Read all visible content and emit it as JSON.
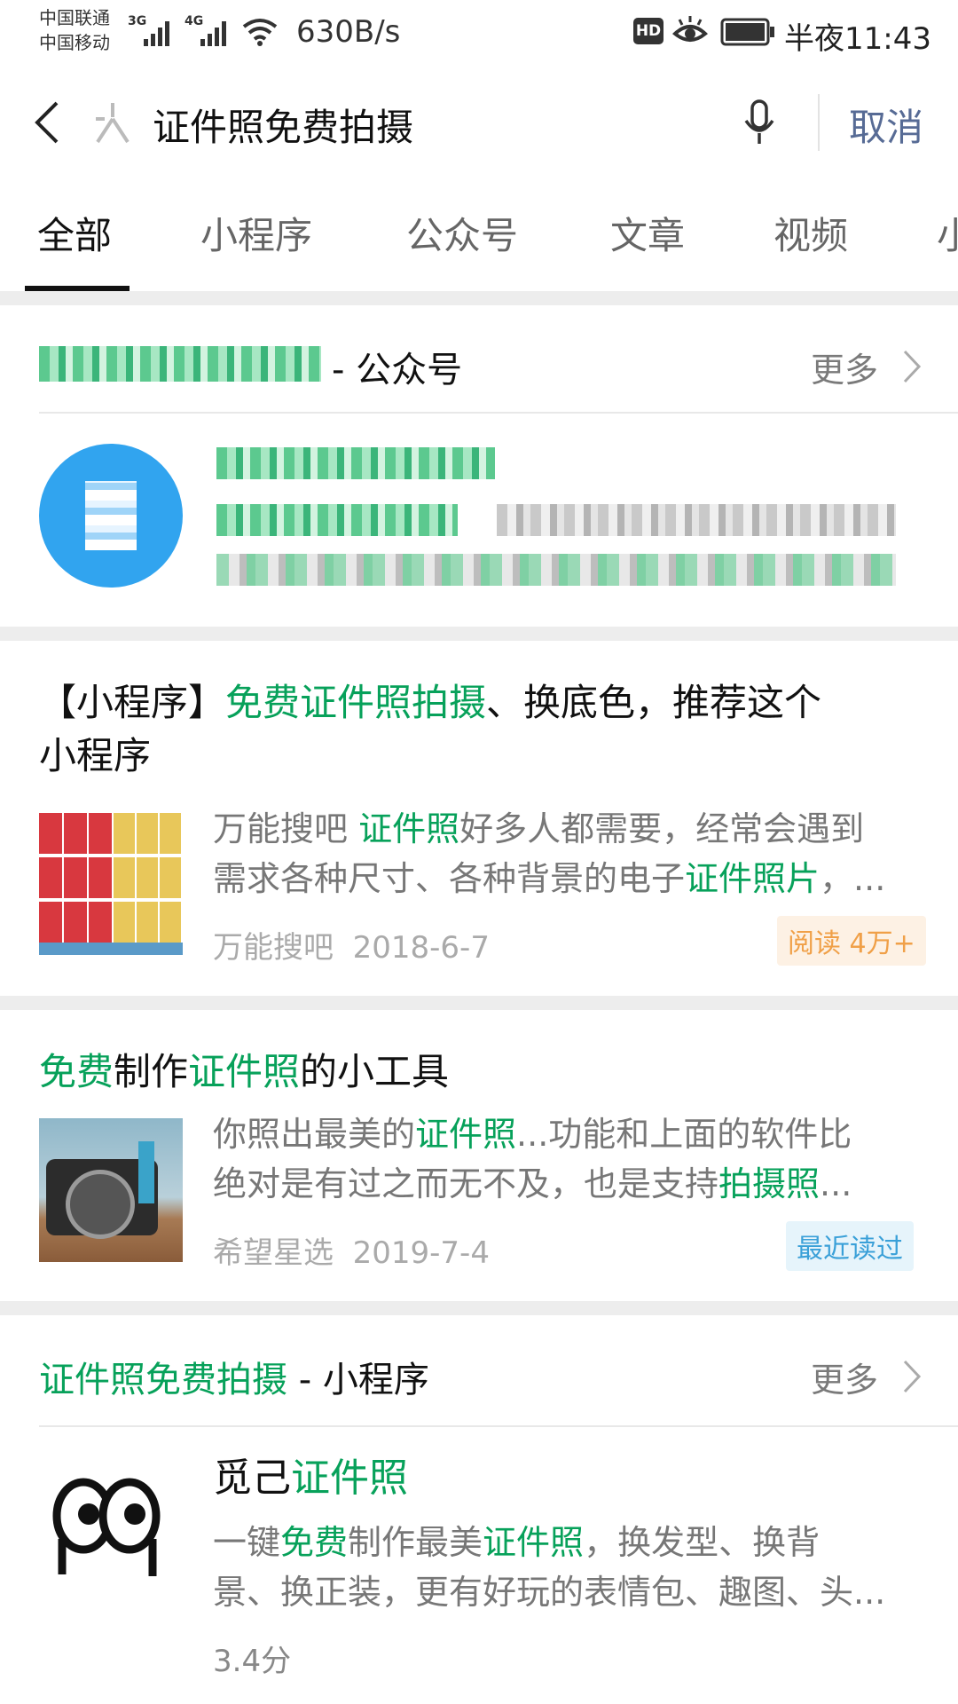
{
  "status": {
    "carrier1": "中国联通",
    "carrier2": "中国移动",
    "net1": "3G",
    "net2": "4G",
    "speed": "630B/s",
    "hd": "HD",
    "time": "半夜11:43"
  },
  "search": {
    "query": "证件照免费拍摄",
    "cancel": "取消"
  },
  "tabs": [
    "全部",
    "小程序",
    "公众号",
    "文章",
    "视频",
    "小"
  ],
  "account_section": {
    "suffix": "- 公众号",
    "more": "更多"
  },
  "articles": [
    {
      "title_parts": [
        "【小程序】",
        "免费证件照拍摄",
        "、换底色，推荐这个",
        "小程序"
      ],
      "desc_line1_parts": [
        "万能搜吧 ",
        "证件照",
        "好多人都需要，经常会遇到"
      ],
      "desc_line2_parts": [
        "需求各种尺寸、各种背景的电子",
        "证件照片",
        "，..."
      ],
      "source": "万能搜吧",
      "date": "2018-6-7",
      "tag": "阅读 4万+"
    },
    {
      "title_parts": [
        "免费",
        "制作",
        "证件照",
        "的小工具"
      ],
      "desc_line1_parts": [
        "你照出最美的",
        "证件照",
        "...功能和上面的软件比"
      ],
      "desc_line2_parts": [
        "绝对是有过之而无不及，也是支持",
        "拍摄照",
        "..."
      ],
      "source": "希望星选",
      "date": "2019-7-4",
      "tag": "最近读过"
    }
  ],
  "miniprogram_section": {
    "head_hl": "证件照免费拍摄",
    "head_suffix": " - 小程序",
    "more": "更多",
    "item": {
      "name_parts": [
        "觅己",
        "证件照"
      ],
      "desc_line1_parts": [
        "一键",
        "免费",
        "制作最美",
        "证件照",
        "，换发型、换背"
      ],
      "desc_line2": "景、换正装，更有好玩的表情包、趣图、头...",
      "score": "3.4分"
    }
  },
  "colors": {
    "highlight": "#07a15a",
    "cancel": "#576b95",
    "read_tag_bg": "#fdf1e4",
    "read_tag_text": "#f0a048",
    "recent_tag_bg": "#e6f4fb",
    "recent_tag_text": "#3aa0d8",
    "account_avatar": "#31a4ef"
  }
}
